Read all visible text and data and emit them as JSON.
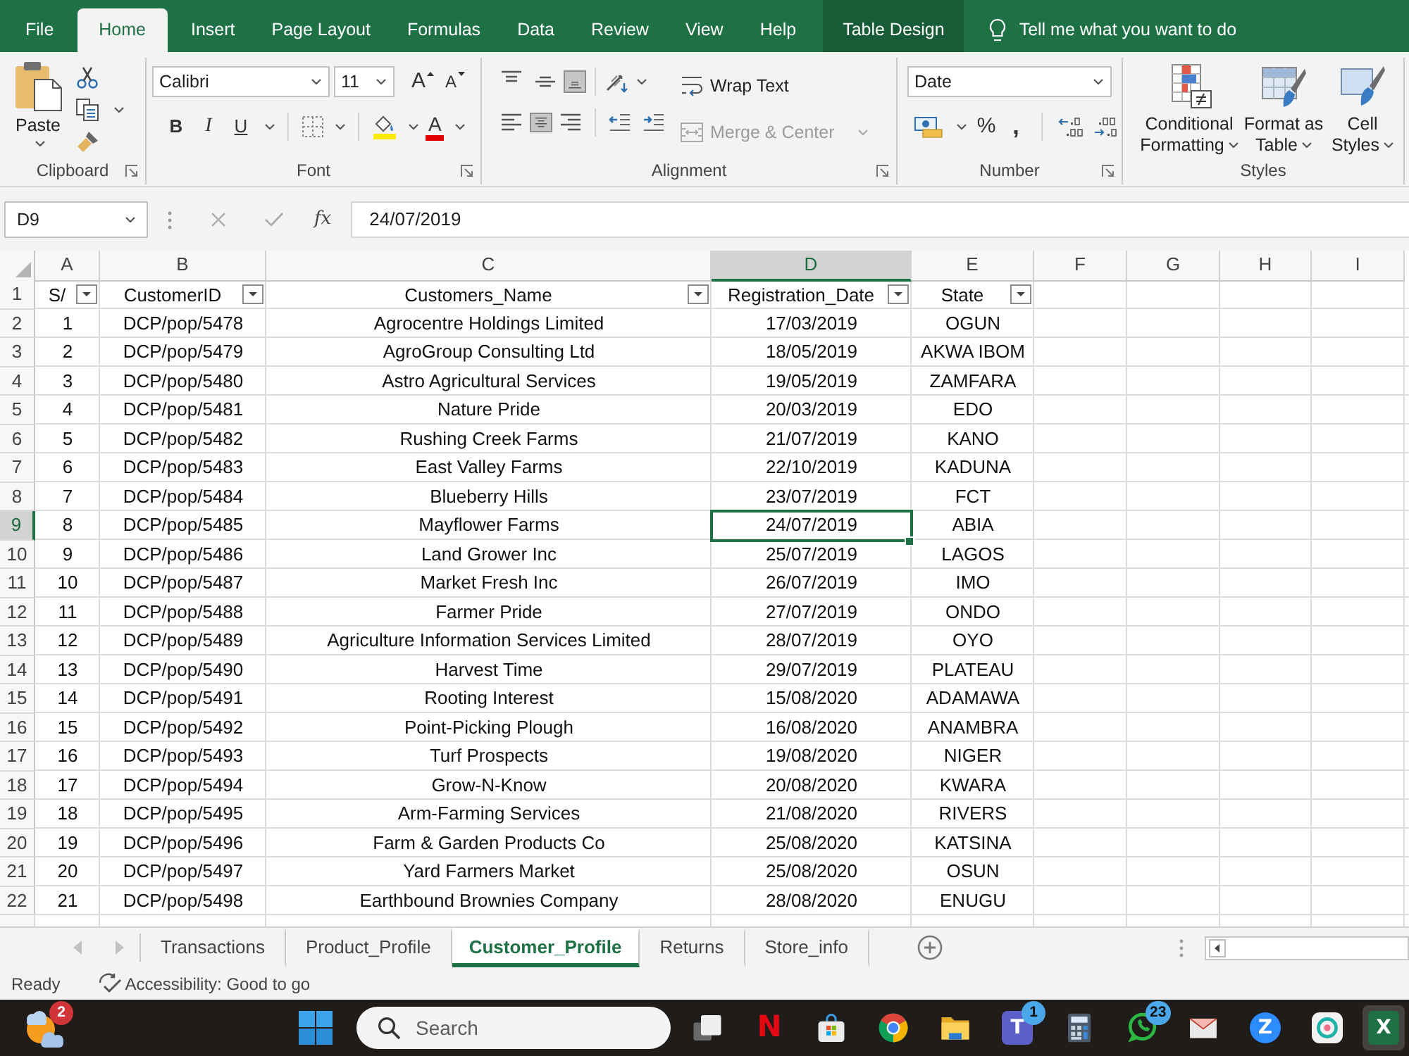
{
  "ribbon_tabs": [
    {
      "label": "File",
      "selected": false,
      "contextual": false
    },
    {
      "label": "Home",
      "selected": true,
      "contextual": false
    },
    {
      "label": "Insert",
      "selected": false,
      "contextual": false
    },
    {
      "label": "Page Layout",
      "selected": false,
      "contextual": false
    },
    {
      "label": "Formulas",
      "selected": false,
      "contextual": false
    },
    {
      "label": "Data",
      "selected": false,
      "contextual": false
    },
    {
      "label": "Review",
      "selected": false,
      "contextual": false
    },
    {
      "label": "View",
      "selected": false,
      "contextual": false
    },
    {
      "label": "Help",
      "selected": false,
      "contextual": false
    },
    {
      "label": "Table Design",
      "selected": false,
      "contextual": true
    }
  ],
  "tell_me": {
    "placeholder": "Tell me what you want to do"
  },
  "ribbon": {
    "clipboard": {
      "label": "Clipboard",
      "paste": "Paste"
    },
    "font": {
      "label": "Font",
      "font_name": "Calibri",
      "font_size": "11",
      "size_buttons": [
        {
          "kind": "grow",
          "text": "A"
        },
        {
          "kind": "shrink",
          "text": "A"
        }
      ],
      "style_buttons": [
        {
          "kind": "bold",
          "text": "B"
        },
        {
          "kind": "italic",
          "text": "I"
        },
        {
          "kind": "underline",
          "text": "U"
        }
      ],
      "font_color": "A"
    },
    "alignment": {
      "label": "Alignment",
      "vertical": [
        {
          "kind": "top",
          "selected": false
        },
        {
          "kind": "middle",
          "selected": false
        },
        {
          "kind": "bottom",
          "selected": true
        }
      ],
      "horizontal": [
        {
          "kind": "left",
          "selected": false
        },
        {
          "kind": "center",
          "selected": true
        },
        {
          "kind": "right",
          "selected": false
        }
      ],
      "wrap_text": "Wrap Text",
      "merge": {
        "text": "Merge & Center",
        "disabled": true
      }
    },
    "number": {
      "label": "Number",
      "format": "Date",
      "symbols": [
        {
          "kind": "percent",
          "text": "%"
        },
        {
          "kind": "comma",
          "text": ","
        }
      ]
    },
    "styles": {
      "label": "Styles",
      "buttons": [
        "Conditional Formatting",
        "Format as Table",
        "Cell Styles"
      ]
    }
  },
  "formula_bar": {
    "name_box": "D9",
    "function_button": "fx",
    "formula": "24/07/2019"
  },
  "sheet": {
    "column_headers": [
      {
        "label": "A",
        "selected": false
      },
      {
        "label": "B",
        "selected": false
      },
      {
        "label": "C",
        "selected": false
      },
      {
        "label": "D",
        "selected": true
      },
      {
        "label": "E",
        "selected": false
      },
      {
        "label": "F",
        "selected": false
      },
      {
        "label": "G",
        "selected": false
      },
      {
        "label": "H",
        "selected": false
      },
      {
        "label": "I",
        "selected": false
      }
    ],
    "row_headers": [
      {
        "label": "1",
        "selected": false
      },
      {
        "label": "2",
        "selected": false
      },
      {
        "label": "3",
        "selected": false
      },
      {
        "label": "4",
        "selected": false
      },
      {
        "label": "5",
        "selected": false
      },
      {
        "label": "6",
        "selected": false
      },
      {
        "label": "7",
        "selected": false
      },
      {
        "label": "8",
        "selected": false
      },
      {
        "label": "9",
        "selected": true
      },
      {
        "label": "10",
        "selected": false
      },
      {
        "label": "11",
        "selected": false
      },
      {
        "label": "12",
        "selected": false
      },
      {
        "label": "13",
        "selected": false
      },
      {
        "label": "14",
        "selected": false
      },
      {
        "label": "15",
        "selected": false
      },
      {
        "label": "16",
        "selected": false
      },
      {
        "label": "17",
        "selected": false
      },
      {
        "label": "18",
        "selected": false
      },
      {
        "label": "19",
        "selected": false
      },
      {
        "label": "20",
        "selected": false
      },
      {
        "label": "21",
        "selected": false
      },
      {
        "label": "22",
        "selected": false
      }
    ],
    "table_headers": [
      {
        "text": "S/",
        "filter": true
      },
      {
        "text": "CustomerID",
        "filter": true
      },
      {
        "text": "Customers_Name",
        "filter": true
      },
      {
        "text": "Registration_Date",
        "filter": true
      },
      {
        "text": "State",
        "filter": true
      }
    ],
    "rows": [
      [
        "1",
        "DCP/pop/5478",
        "Agrocentre Holdings Limited",
        "17/03/2019",
        "OGUN"
      ],
      [
        "2",
        "DCP/pop/5479",
        "AgroGroup Consulting Ltd",
        "18/05/2019",
        "AKWA IBOM"
      ],
      [
        "3",
        "DCP/pop/5480",
        "Astro Agricultural Services",
        "19/05/2019",
        "ZAMFARA"
      ],
      [
        "4",
        "DCP/pop/5481",
        "Nature Pride",
        "20/03/2019",
        "EDO"
      ],
      [
        "5",
        "DCP/pop/5482",
        "Rushing Creek Farms",
        "21/07/2019",
        "KANO"
      ],
      [
        "6",
        "DCP/pop/5483",
        "East Valley Farms",
        "22/10/2019",
        "KADUNA"
      ],
      [
        "7",
        "DCP/pop/5484",
        "Blueberry Hills",
        "23/07/2019",
        "FCT"
      ],
      [
        "8",
        "DCP/pop/5485",
        "Mayflower Farms",
        "24/07/2019",
        "ABIA"
      ],
      [
        "9",
        "DCP/pop/5486",
        "Land Grower Inc",
        "25/07/2019",
        "LAGOS"
      ],
      [
        "10",
        "DCP/pop/5487",
        "Market Fresh Inc",
        "26/07/2019",
        "IMO"
      ],
      [
        "11",
        "DCP/pop/5488",
        "Farmer Pride",
        "27/07/2019",
        "ONDO"
      ],
      [
        "12",
        "DCP/pop/5489",
        "Agriculture Information Services Limited",
        "28/07/2019",
        "OYO"
      ],
      [
        "13",
        "DCP/pop/5490",
        "Harvest Time",
        "29/07/2019",
        "PLATEAU"
      ],
      [
        "14",
        "DCP/pop/5491",
        "Rooting Interest",
        "15/08/2020",
        "ADAMAWA"
      ],
      [
        "15",
        "DCP/pop/5492",
        "Point-Picking Plough",
        "16/08/2020",
        "ANAMBRA"
      ],
      [
        "16",
        "DCP/pop/5493",
        "Turf Prospects",
        "19/08/2020",
        "NIGER"
      ],
      [
        "17",
        "DCP/pop/5494",
        "Grow-N-Know",
        "20/08/2020",
        "KWARA"
      ],
      [
        "18",
        "DCP/pop/5495",
        "Arm-Farming Services",
        "21/08/2020",
        "RIVERS"
      ],
      [
        "19",
        "DCP/pop/5496",
        "Farm & Garden Products Co",
        "25/08/2020",
        "KATSINA"
      ],
      [
        "20",
        "DCP/pop/5497",
        "Yard Farmers Market",
        "25/08/2020",
        "OSUN"
      ],
      [
        "21",
        "DCP/pop/5498",
        "Earthbound Brownies Company",
        "28/08/2020",
        "ENUGU"
      ]
    ]
  },
  "sheet_tabs": [
    {
      "label": "Transactions",
      "selected": false
    },
    {
      "label": "Product_Profile",
      "selected": false
    },
    {
      "label": "Customer_Profile",
      "selected": true
    },
    {
      "label": "Returns",
      "selected": false
    },
    {
      "label": "Store_info",
      "selected": false
    }
  ],
  "status_bar": {
    "mode": "Ready",
    "accessibility": "Accessibility: Good to go"
  },
  "taskbar": {
    "widgets_badge": "2",
    "search": {
      "placeholder": "Search"
    },
    "apps": [
      {
        "kind": "task-view",
        "active": false
      },
      {
        "kind": "netflix",
        "glyph": "N",
        "active": false
      },
      {
        "kind": "store",
        "active": false
      },
      {
        "kind": "chrome",
        "active": false
      },
      {
        "kind": "files",
        "active": false
      },
      {
        "kind": "teams",
        "glyph": "T",
        "badge": "1",
        "active": false
      },
      {
        "kind": "calculator",
        "active": false
      },
      {
        "kind": "whatsapp",
        "badge": "23",
        "active": false
      },
      {
        "kind": "mail",
        "active": false
      },
      {
        "kind": "zoom",
        "glyph": "Z",
        "active": false
      },
      {
        "kind": "ring",
        "active": false
      },
      {
        "kind": "excel",
        "glyph": "X",
        "active": true
      }
    ]
  }
}
